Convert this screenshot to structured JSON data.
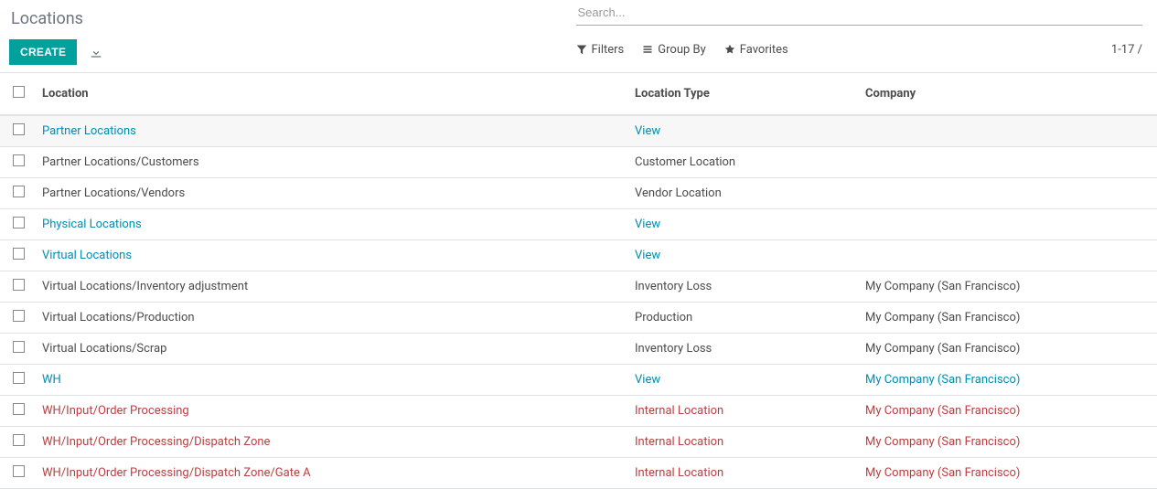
{
  "header": {
    "title": "Locations",
    "create_label": "CREATE",
    "search_placeholder": "Search..."
  },
  "filters": {
    "filters_label": "Filters",
    "groupby_label": "Group By",
    "favorites_label": "Favorites"
  },
  "pager": {
    "text": "1-17 /"
  },
  "columns": {
    "location": "Location",
    "type": "Location Type",
    "company": "Company"
  },
  "rows": [
    {
      "location": "Partner Locations",
      "type": "View",
      "company": "",
      "style": "blue",
      "hl": true
    },
    {
      "location": "Partner Locations/Customers",
      "type": "Customer Location",
      "company": "",
      "style": "plain"
    },
    {
      "location": "Partner Locations/Vendors",
      "type": "Vendor Location",
      "company": "",
      "style": "plain"
    },
    {
      "location": "Physical Locations",
      "type": "View",
      "company": "",
      "style": "blue"
    },
    {
      "location": "Virtual Locations",
      "type": "View",
      "company": "",
      "style": "blue"
    },
    {
      "location": "Virtual Locations/Inventory adjustment",
      "type": "Inventory Loss",
      "company": "My Company (San Francisco)",
      "style": "plain"
    },
    {
      "location": "Virtual Locations/Production",
      "type": "Production",
      "company": "My Company (San Francisco)",
      "style": "plain"
    },
    {
      "location": "Virtual Locations/Scrap",
      "type": "Inventory Loss",
      "company": "My Company (San Francisco)",
      "style": "plain"
    },
    {
      "location": "WH",
      "type": "View",
      "company": "My Company (San Francisco)",
      "style": "blue"
    },
    {
      "location": "WH/Input/Order Processing",
      "type": "Internal Location",
      "company": "My Company (San Francisco)",
      "style": "red"
    },
    {
      "location": "WH/Input/Order Processing/Dispatch Zone",
      "type": "Internal Location",
      "company": "My Company (San Francisco)",
      "style": "red"
    },
    {
      "location": "WH/Input/Order Processing/Dispatch Zone/Gate A",
      "type": "Internal Location",
      "company": "My Company (San Francisco)",
      "style": "red"
    }
  ]
}
